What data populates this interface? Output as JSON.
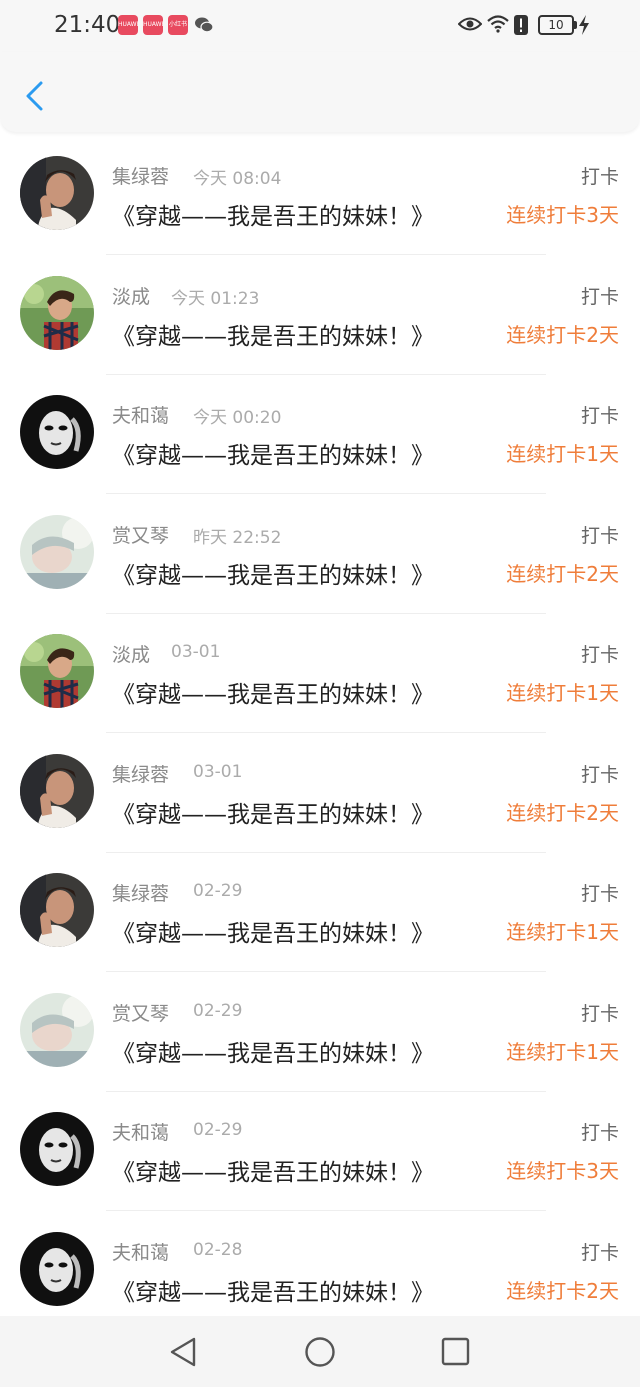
{
  "status_bar": {
    "time": "21:40",
    "app_icons": [
      "HUAWEI",
      "HUAWEI",
      "小红书"
    ],
    "battery": "10"
  },
  "header": {
    "back_icon": "chevron-left-icon"
  },
  "colors": {
    "accent": "#2b9bf0",
    "streak": "#ef7d3a"
  },
  "items": [
    {
      "name": "集绿蓉",
      "time": "今天 08:04",
      "title": "《穿越——我是吾王的妹妹！》",
      "action": "打卡",
      "streak": "连续打卡3天",
      "avatar": "a"
    },
    {
      "name": "淡成",
      "time": "今天 01:23",
      "title": "《穿越——我是吾王的妹妹！》",
      "action": "打卡",
      "streak": "连续打卡2天",
      "avatar": "b"
    },
    {
      "name": "夫和蔼",
      "time": "今天 00:20",
      "title": "《穿越——我是吾王的妹妹！》",
      "action": "打卡",
      "streak": "连续打卡1天",
      "avatar": "c"
    },
    {
      "name": "赏又琴",
      "time": "昨天 22:52",
      "title": "《穿越——我是吾王的妹妹！》",
      "action": "打卡",
      "streak": "连续打卡2天",
      "avatar": "d"
    },
    {
      "name": "淡成",
      "time": "03-01",
      "title": "《穿越——我是吾王的妹妹！》",
      "action": "打卡",
      "streak": "连续打卡1天",
      "avatar": "b"
    },
    {
      "name": "集绿蓉",
      "time": "03-01",
      "title": "《穿越——我是吾王的妹妹！》",
      "action": "打卡",
      "streak": "连续打卡2天",
      "avatar": "a"
    },
    {
      "name": "集绿蓉",
      "time": "02-29",
      "title": "《穿越——我是吾王的妹妹！》",
      "action": "打卡",
      "streak": "连续打卡1天",
      "avatar": "a"
    },
    {
      "name": "赏又琴",
      "time": "02-29",
      "title": "《穿越——我是吾王的妹妹！》",
      "action": "打卡",
      "streak": "连续打卡1天",
      "avatar": "d"
    },
    {
      "name": "夫和蔼",
      "time": "02-29",
      "title": "《穿越——我是吾王的妹妹！》",
      "action": "打卡",
      "streak": "连续打卡3天",
      "avatar": "c"
    },
    {
      "name": "夫和蔼",
      "time": "02-28",
      "title": "《穿越——我是吾王的妹妹！》",
      "action": "打卡",
      "streak": "连续打卡2天",
      "avatar": "c"
    }
  ],
  "nav_bar": {
    "back_icon": "triangle-back-icon",
    "home_icon": "circle-home-icon",
    "recent_icon": "square-recents-icon"
  }
}
